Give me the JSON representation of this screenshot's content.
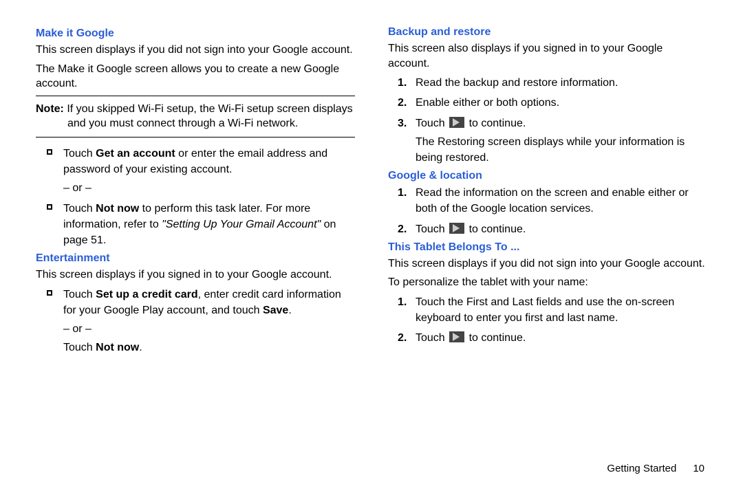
{
  "left": {
    "makeItGoogle": {
      "title": "Make it Google",
      "p1": "This screen displays if you did not sign into your Google account.",
      "p2": "The Make it Google screen allows you to create a new Google account.",
      "noteLabel": "Note:",
      "noteText": " If you skipped Wi-Fi setup, the Wi-Fi setup screen displays and you must connect through a Wi-Fi network.",
      "b1a": "Touch ",
      "b1b": "Get an account",
      "b1c": " or enter the email address and password of your existing account.",
      "or": "– or –",
      "b2a": "Touch ",
      "b2b": "Not now",
      "b2c": " to perform this task later. For more information, refer to ",
      "b2d": "\"Setting Up Your Gmail Account\"",
      "b2e": " on page 51."
    },
    "entertainment": {
      "title": "Entertainment",
      "p1": "This screen displays if you signed in to your Google account.",
      "b1a": "Touch ",
      "b1b": "Set up a credit card",
      "b1c": ", enter credit card information for your Google Play account, and touch ",
      "b1d": "Save",
      "b1e": ".",
      "or": "– or –",
      "b2a": "Touch ",
      "b2b": "Not now",
      "b2c": "."
    }
  },
  "right": {
    "backup": {
      "title": "Backup and restore",
      "p1": "This screen also displays if you signed in to your Google account.",
      "s1": "Read the backup and restore information.",
      "s2": "Enable either or both options.",
      "s3a": "Touch ",
      "s3b": " to continue.",
      "s3c": "The Restoring screen displays while your information is being restored."
    },
    "location": {
      "title": "Google & location",
      "s1": "Read the information on the screen and enable either or both of the Google location services.",
      "s2a": "Touch ",
      "s2b": " to continue."
    },
    "belongs": {
      "title": "This Tablet Belongs To ...",
      "p1": "This screen displays if you did not sign into your Google account.",
      "p2": "To personalize the tablet with your name:",
      "s1": "Touch the First and Last fields and use the on-screen keyboard to enter you first and last name.",
      "s2a": "Touch ",
      "s2b": " to continue."
    }
  },
  "footer": {
    "section": "Getting Started",
    "page": "10"
  }
}
